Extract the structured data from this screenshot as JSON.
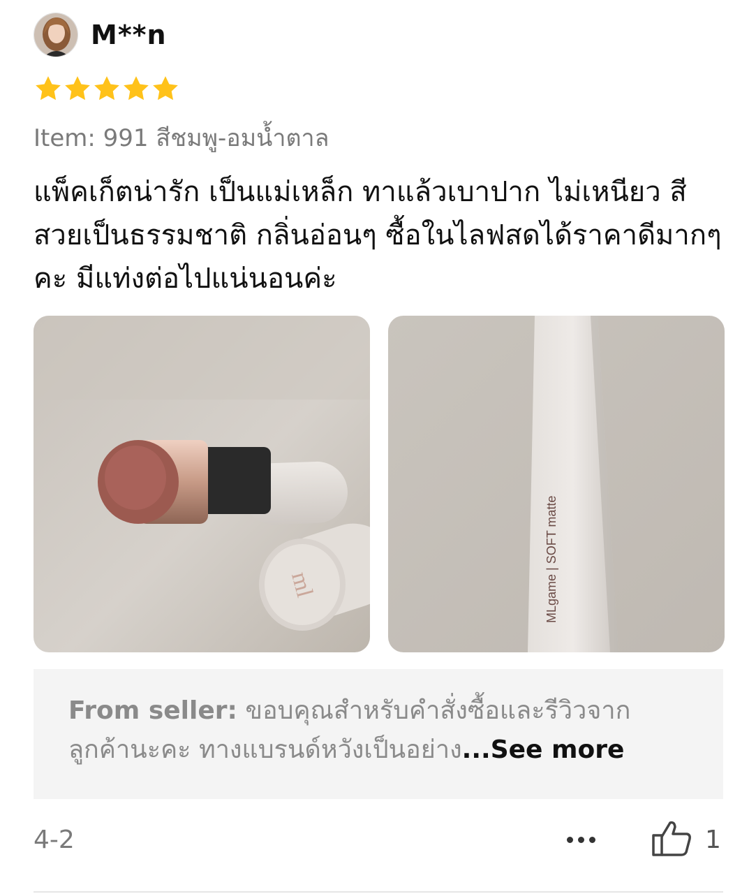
{
  "review": {
    "username": "M**n",
    "rating": 5,
    "item_label": "Item:",
    "item_value": "991 สีชมพู-อมน้ำตาล",
    "text": "แพ็คเก็ตน่ารัก เป็นแม่เหล็ก ทาแล้วเบาปาก ไม่เหนียว สีสวยเป็นธรรมชาติ กลิ่นอ่อนๆ ซื้อในไลฟสดได้ราคาดีมากๆคะ มีแท่งต่อไปแน่นอนค่ะ",
    "photo_text": {
      "brand_mark": "ml",
      "tube_print": "MLgame | SOFT matte"
    }
  },
  "seller_reply": {
    "label": "From seller:",
    "text": " ขอบคุณสำหรับคำสั่งซื้อและรีวิวจากลูกค้านะคะ ทางแบรนด์หวังเป็นอย่าง",
    "see_more": "...See more"
  },
  "footer": {
    "date": "4-2",
    "like_count": "1"
  },
  "colors": {
    "star": "#FFC21A",
    "seller_bg": "#F4F4F4",
    "muted_text": "#7A7A7A"
  },
  "icons": {
    "stars": "star-icon",
    "more": "more-dots-icon",
    "like": "thumbs-up-icon"
  }
}
